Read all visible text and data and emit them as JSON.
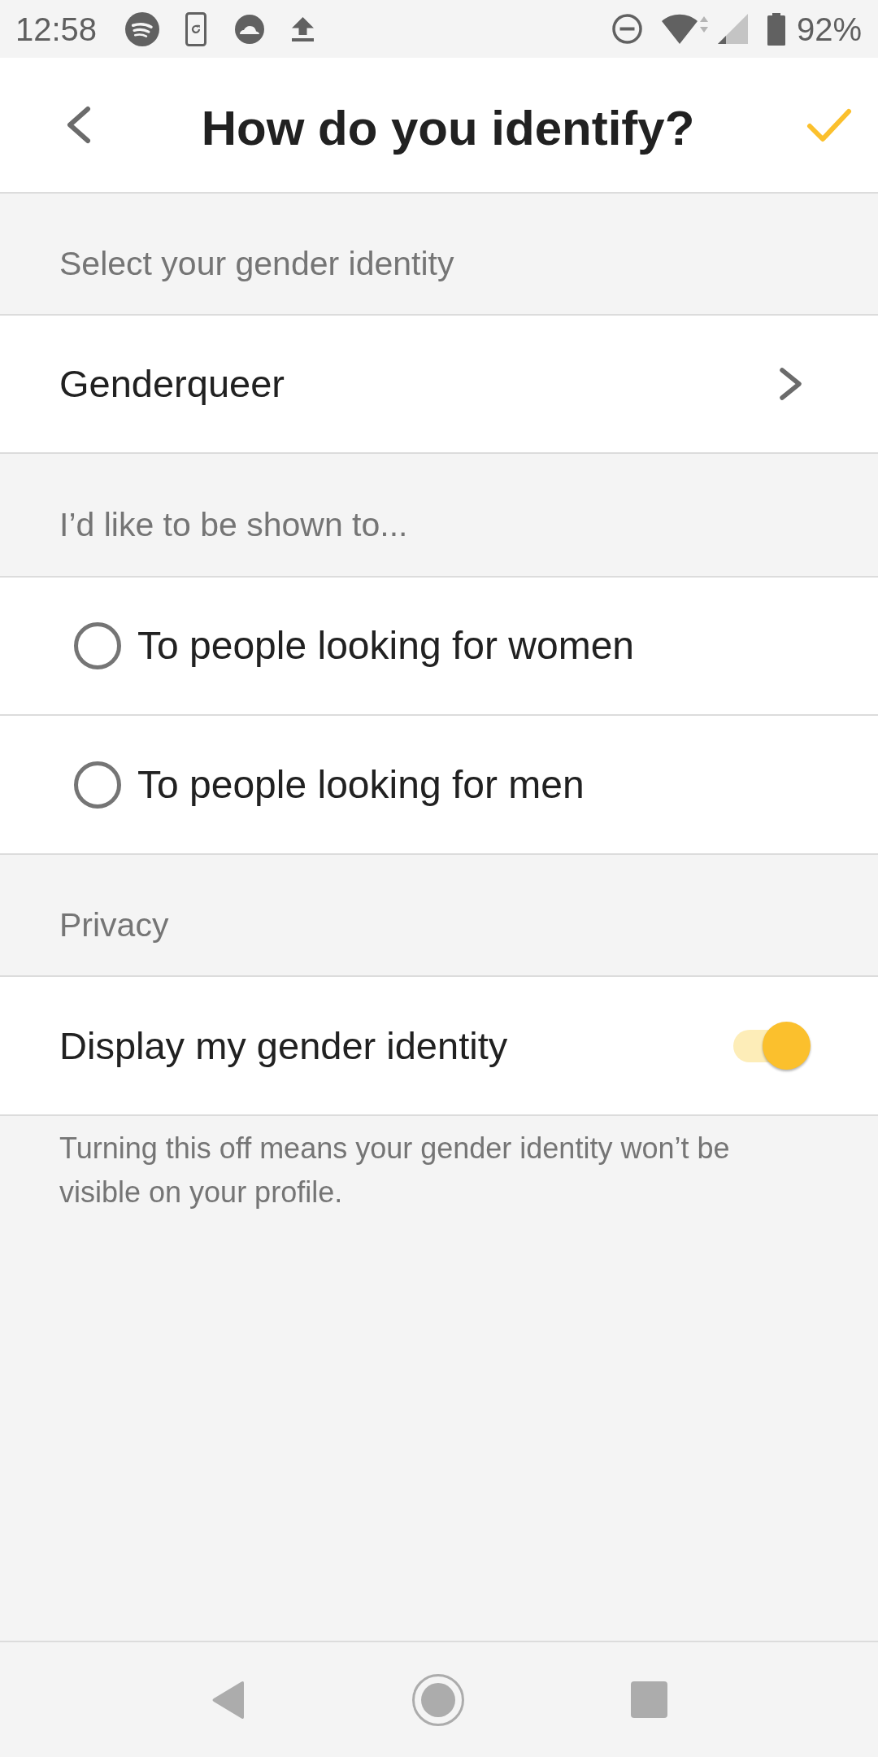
{
  "status_bar": {
    "time": "12:58",
    "battery": "92%"
  },
  "header": {
    "title": "How do you identify?"
  },
  "gender": {
    "section_label": "Select your gender identity",
    "value": "Genderqueer"
  },
  "shown_to": {
    "section_label": "I’d like to be shown to...",
    "options": [
      {
        "label": "To people looking for women",
        "selected": false
      },
      {
        "label": "To people looking for men",
        "selected": false
      }
    ]
  },
  "privacy": {
    "section_label": "Privacy",
    "toggle": {
      "label": "Display my gender identity",
      "on": true
    },
    "note": "Turning this off means your gender identity won’t be visible on your profile."
  }
}
